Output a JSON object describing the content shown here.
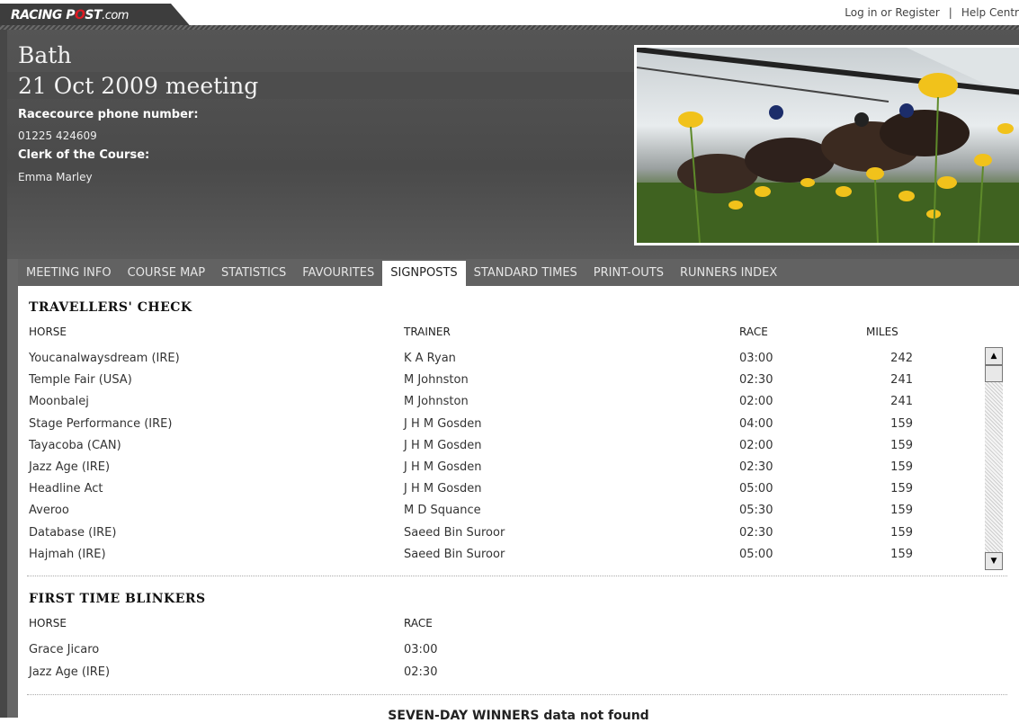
{
  "topbar": {
    "logo_text_a": "RACING P",
    "logo_text_o": "O",
    "logo_text_b": "ST",
    "logo_text_com": ".com",
    "login": "Log in or Register",
    "separator": "|",
    "help": "Help Centr"
  },
  "header": {
    "venue": "Bath",
    "meeting": "21 Oct 2009 meeting",
    "phone_label": "Racecource phone number:",
    "phone": "01225 424609",
    "clerk_label": "Clerk of the Course:",
    "clerk": "Emma Marley"
  },
  "tabs": [
    {
      "label": "MEETING INFO"
    },
    {
      "label": "COURSE MAP"
    },
    {
      "label": "STATISTICS"
    },
    {
      "label": "FAVOURITES"
    },
    {
      "label": "SIGNPOSTS"
    },
    {
      "label": "STANDARD TIMES"
    },
    {
      "label": "PRINT-OUTS"
    },
    {
      "label": "RUNNERS INDEX"
    }
  ],
  "active_tab": "SIGNPOSTS",
  "travellers": {
    "title": "TRAVELLERS' CHECK",
    "columns": {
      "horse": "HORSE",
      "trainer": "TRAINER",
      "race": "RACE",
      "miles": "MILES"
    },
    "rows": [
      {
        "horse": "Youcanalwaysdream (IRE)",
        "trainer": "K A Ryan",
        "race": "03:00",
        "miles": "242"
      },
      {
        "horse": "Temple Fair (USA)",
        "trainer": "M Johnston",
        "race": "02:30",
        "miles": "241"
      },
      {
        "horse": "Moonbalej",
        "trainer": "M Johnston",
        "race": "02:00",
        "miles": "241"
      },
      {
        "horse": "Stage Performance (IRE)",
        "trainer": "J H M Gosden",
        "race": "04:00",
        "miles": "159"
      },
      {
        "horse": "Tayacoba (CAN)",
        "trainer": "J H M Gosden",
        "race": "02:00",
        "miles": "159"
      },
      {
        "horse": "Jazz Age (IRE)",
        "trainer": "J H M Gosden",
        "race": "02:30",
        "miles": "159"
      },
      {
        "horse": "Headline Act",
        "trainer": "J H M Gosden",
        "race": "05:00",
        "miles": "159"
      },
      {
        "horse": "Averoo",
        "trainer": "M D Squance",
        "race": "05:30",
        "miles": "159"
      },
      {
        "horse": "Database (IRE)",
        "trainer": "Saeed Bin Suroor",
        "race": "02:30",
        "miles": "159"
      },
      {
        "horse": "Hajmah (IRE)",
        "trainer": "Saeed Bin Suroor",
        "race": "05:00",
        "miles": "159"
      }
    ]
  },
  "blinkers": {
    "title": "FIRST TIME BLINKERS",
    "columns": {
      "horse": "HORSE",
      "race": "RACE"
    },
    "rows": [
      {
        "horse": "Grace Jicaro",
        "race": "03:00"
      },
      {
        "horse": "Jazz Age (IRE)",
        "race": "02:30"
      }
    ]
  },
  "seven_day": "SEVEN-DAY WINNERS data not found"
}
